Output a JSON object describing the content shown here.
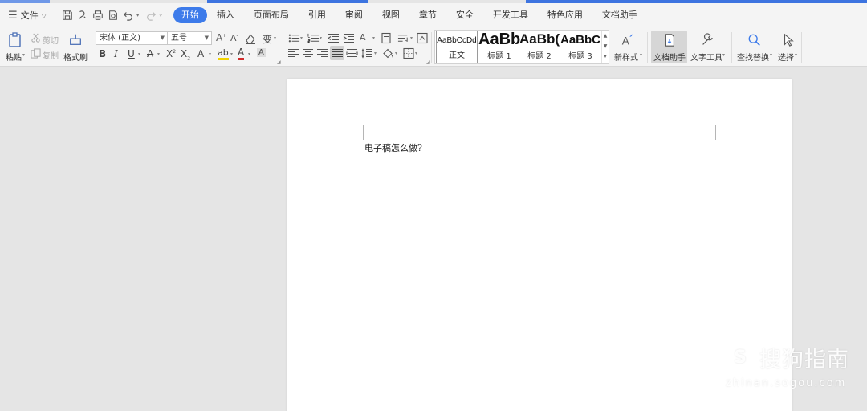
{
  "menubar": {
    "file_label": "文件",
    "tabs": [
      "开始",
      "插入",
      "页面布局",
      "引用",
      "审阅",
      "视图",
      "章节",
      "安全",
      "开发工具",
      "特色应用",
      "文档助手"
    ],
    "active_tab": "开始"
  },
  "ribbon": {
    "paste_label": "粘贴",
    "cut_label": "剪切",
    "copy_label": "复制",
    "format_painter_label": "格式刷",
    "font_name": "宋体 (正文)",
    "font_size": "五号",
    "styles": [
      {
        "preview": "AaBbCcDd",
        "name": "正文"
      },
      {
        "preview": "AaBb",
        "name": "标题 1"
      },
      {
        "preview": "AaBb(",
        "name": "标题 2"
      },
      {
        "preview": "AaBbC",
        "name": "标题 3"
      }
    ],
    "new_style_label": "新样式",
    "doc_assistant_label": "文档助手",
    "text_tools_label": "文字工具",
    "find_replace_label": "查找替换",
    "select_label": "选择",
    "font_color_accent": "#d12b2b",
    "highlight_accent": "#f2d300",
    "active_tab_color": "#3d7bea"
  },
  "document": {
    "text": "电子稿怎么做?"
  },
  "watermark": {
    "logo": "S",
    "name": "搜狗指南",
    "url": "zhinan.sogou.com"
  }
}
